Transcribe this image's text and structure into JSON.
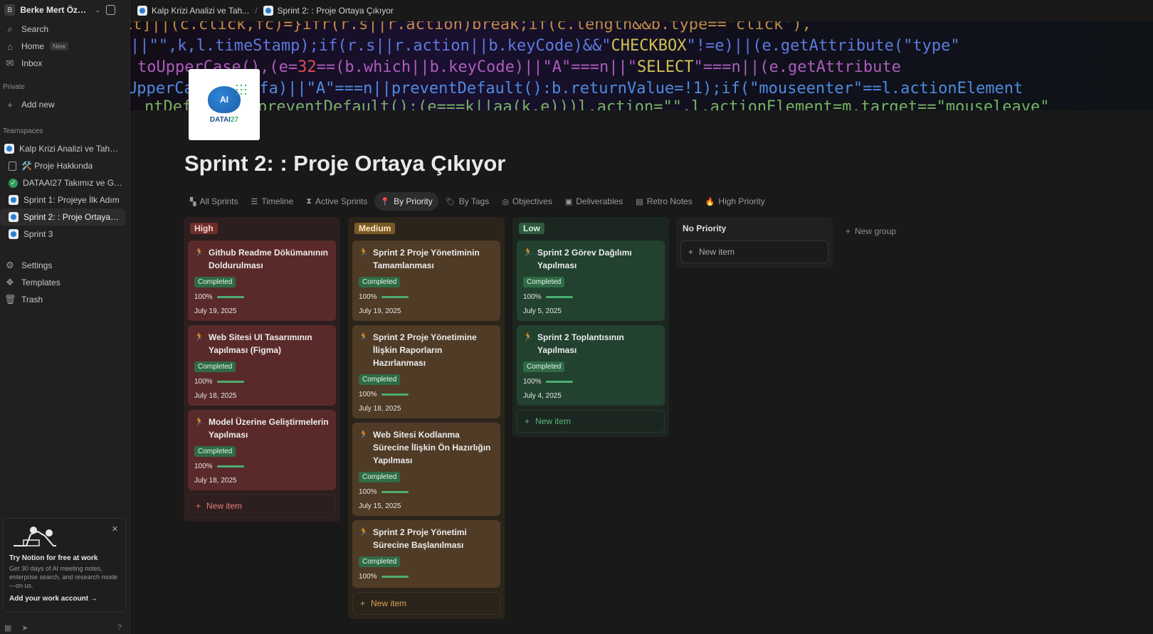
{
  "sidebar": {
    "workspace": {
      "initial": "B",
      "name": "Berke Mert Öztür..."
    },
    "nav": [
      {
        "label": "Search",
        "icon": "search-icon"
      },
      {
        "label": "Home",
        "icon": "home-icon",
        "badge": "New"
      },
      {
        "label": "Inbox",
        "icon": "inbox-icon"
      }
    ],
    "private_label": "Private",
    "add_new": "Add new",
    "teamspaces_label": "Teamspaces",
    "pages": [
      {
        "label": "Kalp Krizi Analizi ve Tahmini"
      },
      {
        "label": "🛠️ Proje Hakkında"
      },
      {
        "label": "DATAAI27 Takımız ve Gör..."
      },
      {
        "label": "Sprint 1: Projeye İlk Adım"
      },
      {
        "label": "Sprint 2: : Proje Ortaya Çı..."
      },
      {
        "label": "Sprint 3"
      }
    ],
    "utilities": [
      {
        "label": "Settings",
        "icon": "gear-icon"
      },
      {
        "label": "Templates",
        "icon": "templates-icon"
      },
      {
        "label": "Trash",
        "icon": "trash-icon"
      }
    ],
    "promo": {
      "title": "Try Notion for free at work",
      "body": "Get 30 days of AI meeting notes, enterprise search, and research mode—on us.",
      "link": "Add your work account"
    }
  },
  "topbar": {
    "crumbs": [
      "Kalp Krizi Analizi ve Tah...",
      "Sprint 2: : Proje Ortaya Çıkıyor"
    ]
  },
  "logo": {
    "mark": "AI",
    "text_a": "DATAI",
    "text_b": "27"
  },
  "page": {
    "title": "Sprint 2: : Proje Ortaya Çıkıyor",
    "tabs": [
      {
        "label": "All Sprints",
        "icon": "sprints-icon"
      },
      {
        "label": "Timeline",
        "icon": "timeline-icon"
      },
      {
        "label": "Active Sprints",
        "icon": "hourglass-icon"
      },
      {
        "label": "By Priority",
        "icon": "pin-icon"
      },
      {
        "label": "By Tags",
        "icon": "tag-icon"
      },
      {
        "label": "Objectives",
        "icon": "target-icon"
      },
      {
        "label": "Deliverables",
        "icon": "box-icon"
      },
      {
        "label": "Retro Notes",
        "icon": "notes-icon"
      },
      {
        "label": "High Priority",
        "icon": "fire-icon"
      }
    ]
  },
  "board": {
    "new_item": "New item",
    "new_group": "New group",
    "groups": [
      {
        "name": "High",
        "cards": [
          {
            "title": "Github Readme Dökümanının Doldurulması",
            "status": "Completed",
            "progress": "100%",
            "date": "July 19, 2025"
          },
          {
            "title": "Web Sitesi UI Tasarımının Yapılması (Figma)",
            "status": "Completed",
            "progress": "100%",
            "date": "July 18, 2025"
          },
          {
            "title": "Model Üzerine Geliştirmelerin Yapılması",
            "status": "Completed",
            "progress": "100%",
            "date": "July 18, 2025"
          }
        ]
      },
      {
        "name": "Medium",
        "cards": [
          {
            "title": "Sprint 2 Proje Yönetiminin Tamamlanması",
            "status": "Completed",
            "progress": "100%",
            "date": "July 19, 2025"
          },
          {
            "title": "Sprint 2 Proje Yönetimine İlişkin Raporların Hazırlanması",
            "status": "Completed",
            "progress": "100%",
            "date": "July 18, 2025"
          },
          {
            "title": "Web Sitesi Kodlanma Sürecine İlişkin Ön Hazırlığın Yapılması",
            "status": "Completed",
            "progress": "100%",
            "date": "July 15, 2025"
          },
          {
            "title": "Sprint 2 Proje Yönetimi Sürecine Başlanılması",
            "status": "Completed",
            "progress": "100%",
            "date": ""
          }
        ]
      },
      {
        "name": "Low",
        "cards": [
          {
            "title": "Sprint 2 Görev Dağılımı Yapılması",
            "status": "Completed",
            "progress": "100%",
            "date": "July 5, 2025"
          },
          {
            "title": "Sprint 2 Toplantısının Yapılması",
            "status": "Completed",
            "progress": "100%",
            "date": "July 4, 2025"
          }
        ]
      },
      {
        "name": "No Priority",
        "cards": []
      }
    ]
  }
}
